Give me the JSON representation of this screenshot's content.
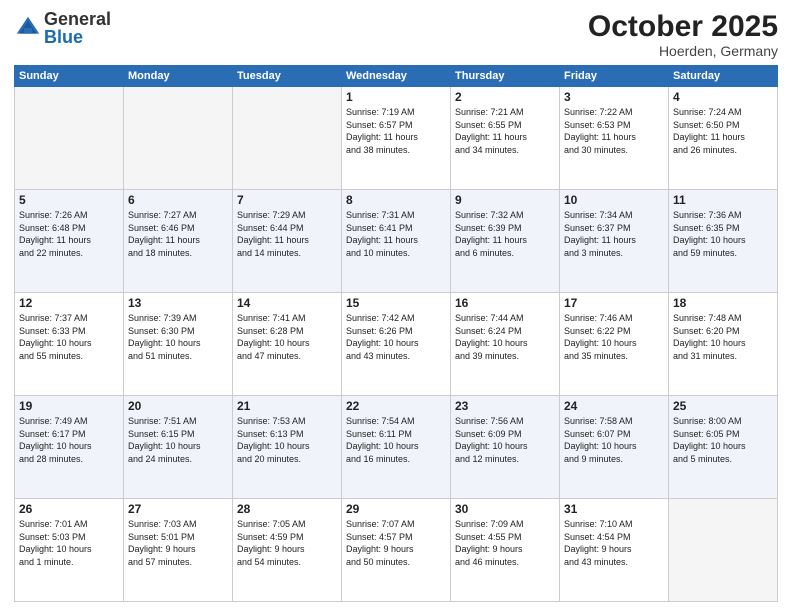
{
  "logo": {
    "general": "General",
    "blue": "Blue"
  },
  "title": "October 2025",
  "location": "Hoerden, Germany",
  "weekdays": [
    "Sunday",
    "Monday",
    "Tuesday",
    "Wednesday",
    "Thursday",
    "Friday",
    "Saturday"
  ],
  "weeks": [
    [
      {
        "day": "",
        "info": ""
      },
      {
        "day": "",
        "info": ""
      },
      {
        "day": "",
        "info": ""
      },
      {
        "day": "1",
        "info": "Sunrise: 7:19 AM\nSunset: 6:57 PM\nDaylight: 11 hours\nand 38 minutes."
      },
      {
        "day": "2",
        "info": "Sunrise: 7:21 AM\nSunset: 6:55 PM\nDaylight: 11 hours\nand 34 minutes."
      },
      {
        "day": "3",
        "info": "Sunrise: 7:22 AM\nSunset: 6:53 PM\nDaylight: 11 hours\nand 30 minutes."
      },
      {
        "day": "4",
        "info": "Sunrise: 7:24 AM\nSunset: 6:50 PM\nDaylight: 11 hours\nand 26 minutes."
      }
    ],
    [
      {
        "day": "5",
        "info": "Sunrise: 7:26 AM\nSunset: 6:48 PM\nDaylight: 11 hours\nand 22 minutes."
      },
      {
        "day": "6",
        "info": "Sunrise: 7:27 AM\nSunset: 6:46 PM\nDaylight: 11 hours\nand 18 minutes."
      },
      {
        "day": "7",
        "info": "Sunrise: 7:29 AM\nSunset: 6:44 PM\nDaylight: 11 hours\nand 14 minutes."
      },
      {
        "day": "8",
        "info": "Sunrise: 7:31 AM\nSunset: 6:41 PM\nDaylight: 11 hours\nand 10 minutes."
      },
      {
        "day": "9",
        "info": "Sunrise: 7:32 AM\nSunset: 6:39 PM\nDaylight: 11 hours\nand 6 minutes."
      },
      {
        "day": "10",
        "info": "Sunrise: 7:34 AM\nSunset: 6:37 PM\nDaylight: 11 hours\nand 3 minutes."
      },
      {
        "day": "11",
        "info": "Sunrise: 7:36 AM\nSunset: 6:35 PM\nDaylight: 10 hours\nand 59 minutes."
      }
    ],
    [
      {
        "day": "12",
        "info": "Sunrise: 7:37 AM\nSunset: 6:33 PM\nDaylight: 10 hours\nand 55 minutes."
      },
      {
        "day": "13",
        "info": "Sunrise: 7:39 AM\nSunset: 6:30 PM\nDaylight: 10 hours\nand 51 minutes."
      },
      {
        "day": "14",
        "info": "Sunrise: 7:41 AM\nSunset: 6:28 PM\nDaylight: 10 hours\nand 47 minutes."
      },
      {
        "day": "15",
        "info": "Sunrise: 7:42 AM\nSunset: 6:26 PM\nDaylight: 10 hours\nand 43 minutes."
      },
      {
        "day": "16",
        "info": "Sunrise: 7:44 AM\nSunset: 6:24 PM\nDaylight: 10 hours\nand 39 minutes."
      },
      {
        "day": "17",
        "info": "Sunrise: 7:46 AM\nSunset: 6:22 PM\nDaylight: 10 hours\nand 35 minutes."
      },
      {
        "day": "18",
        "info": "Sunrise: 7:48 AM\nSunset: 6:20 PM\nDaylight: 10 hours\nand 31 minutes."
      }
    ],
    [
      {
        "day": "19",
        "info": "Sunrise: 7:49 AM\nSunset: 6:17 PM\nDaylight: 10 hours\nand 28 minutes."
      },
      {
        "day": "20",
        "info": "Sunrise: 7:51 AM\nSunset: 6:15 PM\nDaylight: 10 hours\nand 24 minutes."
      },
      {
        "day": "21",
        "info": "Sunrise: 7:53 AM\nSunset: 6:13 PM\nDaylight: 10 hours\nand 20 minutes."
      },
      {
        "day": "22",
        "info": "Sunrise: 7:54 AM\nSunset: 6:11 PM\nDaylight: 10 hours\nand 16 minutes."
      },
      {
        "day": "23",
        "info": "Sunrise: 7:56 AM\nSunset: 6:09 PM\nDaylight: 10 hours\nand 12 minutes."
      },
      {
        "day": "24",
        "info": "Sunrise: 7:58 AM\nSunset: 6:07 PM\nDaylight: 10 hours\nand 9 minutes."
      },
      {
        "day": "25",
        "info": "Sunrise: 8:00 AM\nSunset: 6:05 PM\nDaylight: 10 hours\nand 5 minutes."
      }
    ],
    [
      {
        "day": "26",
        "info": "Sunrise: 7:01 AM\nSunset: 5:03 PM\nDaylight: 10 hours\nand 1 minute."
      },
      {
        "day": "27",
        "info": "Sunrise: 7:03 AM\nSunset: 5:01 PM\nDaylight: 9 hours\nand 57 minutes."
      },
      {
        "day": "28",
        "info": "Sunrise: 7:05 AM\nSunset: 4:59 PM\nDaylight: 9 hours\nand 54 minutes."
      },
      {
        "day": "29",
        "info": "Sunrise: 7:07 AM\nSunset: 4:57 PM\nDaylight: 9 hours\nand 50 minutes."
      },
      {
        "day": "30",
        "info": "Sunrise: 7:09 AM\nSunset: 4:55 PM\nDaylight: 9 hours\nand 46 minutes."
      },
      {
        "day": "31",
        "info": "Sunrise: 7:10 AM\nSunset: 4:54 PM\nDaylight: 9 hours\nand 43 minutes."
      },
      {
        "day": "",
        "info": ""
      }
    ]
  ]
}
